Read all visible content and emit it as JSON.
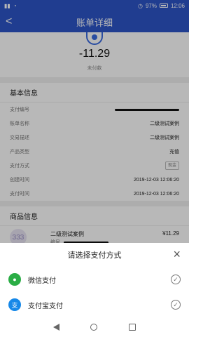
{
  "status_bar": {
    "battery": "97%",
    "time": "12:06"
  },
  "header": {
    "title": "账单详细",
    "back": "<"
  },
  "summary": {
    "amount": "-11.29",
    "amount_label": "未付款"
  },
  "basic_info": {
    "title": "基本信息",
    "rows": [
      {
        "label": "支付编号",
        "value": ""
      },
      {
        "label": "账单名称",
        "value": "二级测试案例"
      },
      {
        "label": "交易描述",
        "value": "二级测试案例"
      },
      {
        "label": "产品类型",
        "value": "充值"
      },
      {
        "label": "支付方式",
        "value": "现金"
      },
      {
        "label": "创建时间",
        "value": "2019-12-03 12:06:20"
      },
      {
        "label": "支付时间",
        "value": "2019-12-03 12:06:20"
      }
    ]
  },
  "goods": {
    "title": "商品信息",
    "thumb": "333",
    "name": "二级测试案例",
    "price": "¥11.29",
    "meta_label": "编号"
  },
  "payment_sheet": {
    "title": "请选择支付方式",
    "close": "×",
    "options": [
      {
        "label": "微信支付",
        "icon": "wechat-icon",
        "selected_icon": "check-icon"
      },
      {
        "label": "支付宝支付",
        "icon": "alipay-icon",
        "selected_icon": "check-icon"
      }
    ]
  },
  "colors": {
    "primary": "#2d55c8",
    "wechat": "#2aad45",
    "alipay": "#1688e8"
  }
}
